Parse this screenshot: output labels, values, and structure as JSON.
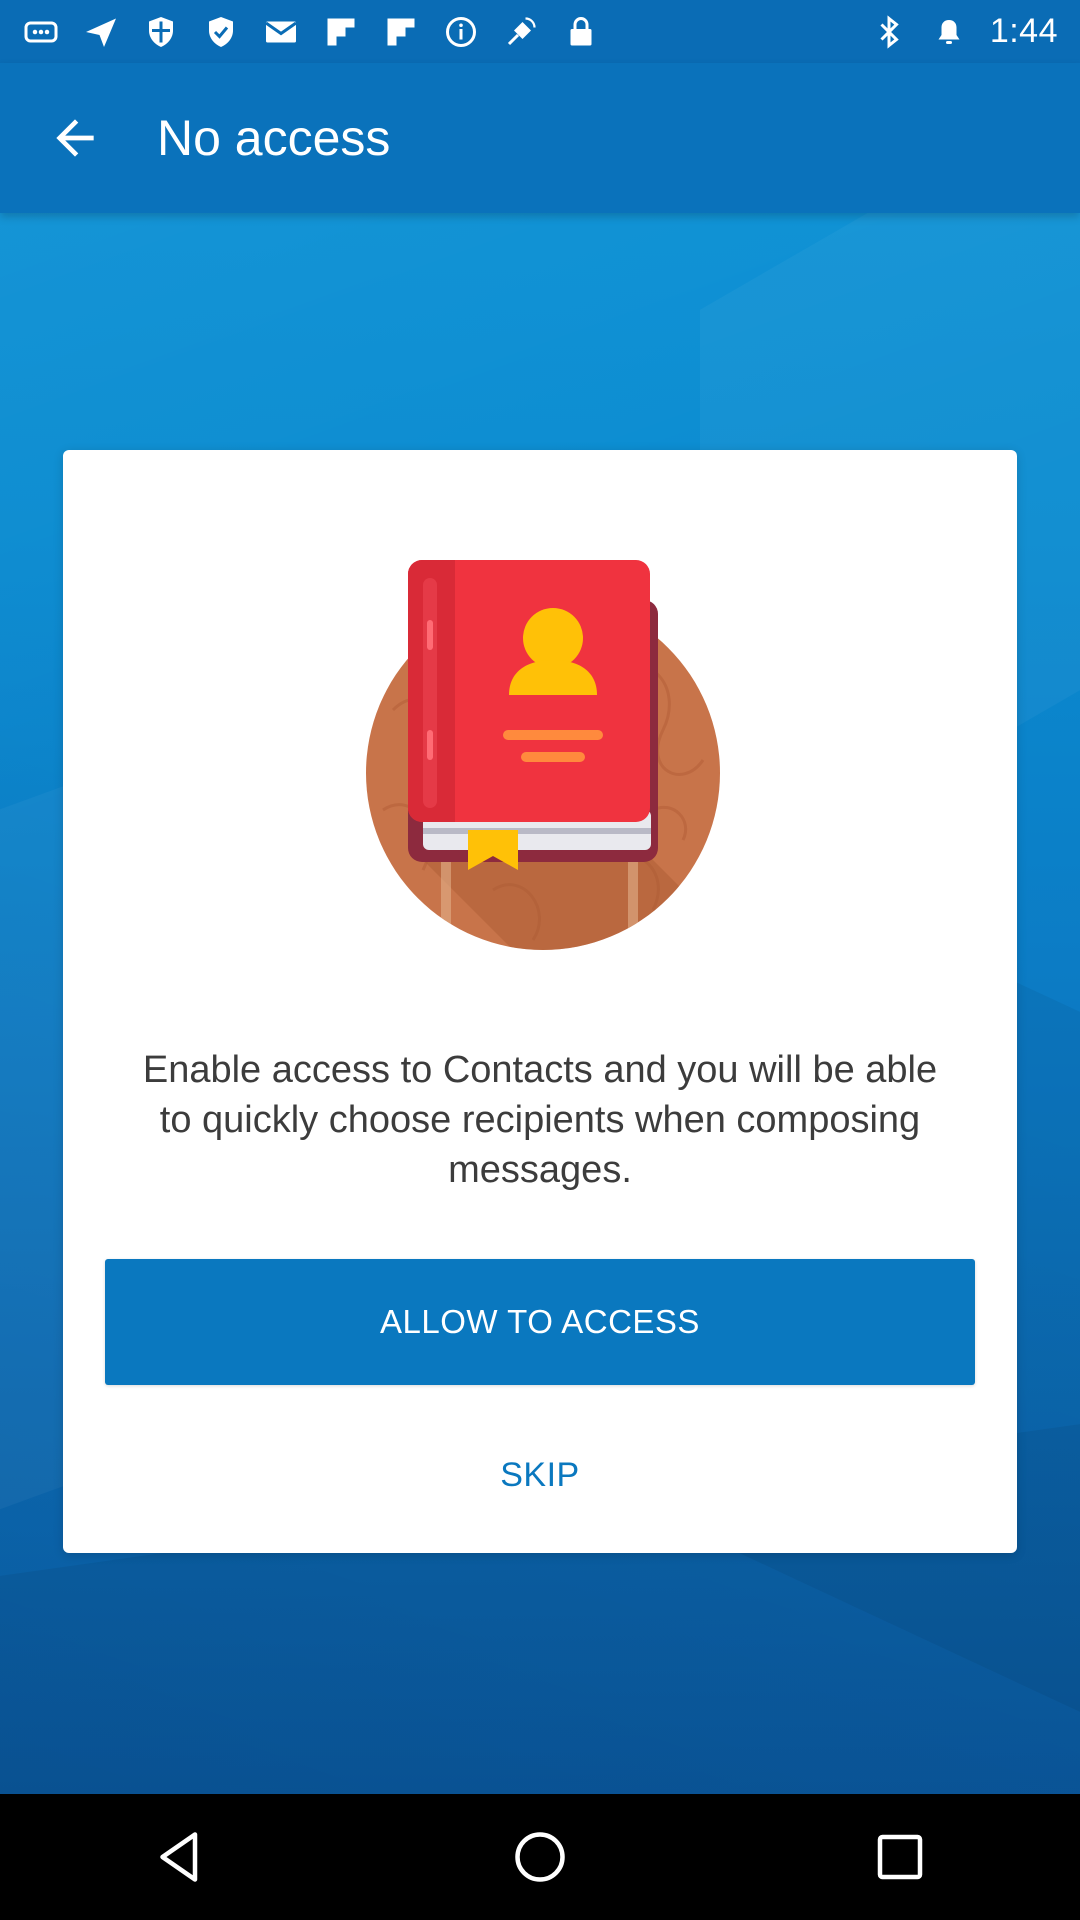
{
  "status_bar": {
    "time": "1:44",
    "left_icons": [
      "more-icon",
      "send-icon",
      "shield-icon",
      "shield-check-icon",
      "mail-icon",
      "flipboard-icon",
      "flipboard-icon",
      "info-icon",
      "fake-gps-icon",
      "lock-icon"
    ],
    "right_icons": [
      "bluetooth-icon",
      "alarm-icon"
    ]
  },
  "app_bar": {
    "title": "No access",
    "back_icon": "back-arrow-icon"
  },
  "card": {
    "illustration": "contacts-book-icon",
    "message": "Enable access to Contacts and you will be able to quickly choose recipients when composing messages.",
    "allow_label": "ALLOW TO ACCESS",
    "skip_label": "SKIP"
  },
  "nav_bar": {
    "back_icon": "nav-back-icon",
    "home_icon": "nav-home-icon",
    "recents_icon": "nav-recents-icon"
  },
  "colors": {
    "primary": "#0a78bf",
    "app_bar": "#0a72bb",
    "status_bar": "#0a6cb5",
    "book_red": "#f0333f",
    "person_yellow": "#ffc107",
    "circle_brown": "#c8744a"
  }
}
